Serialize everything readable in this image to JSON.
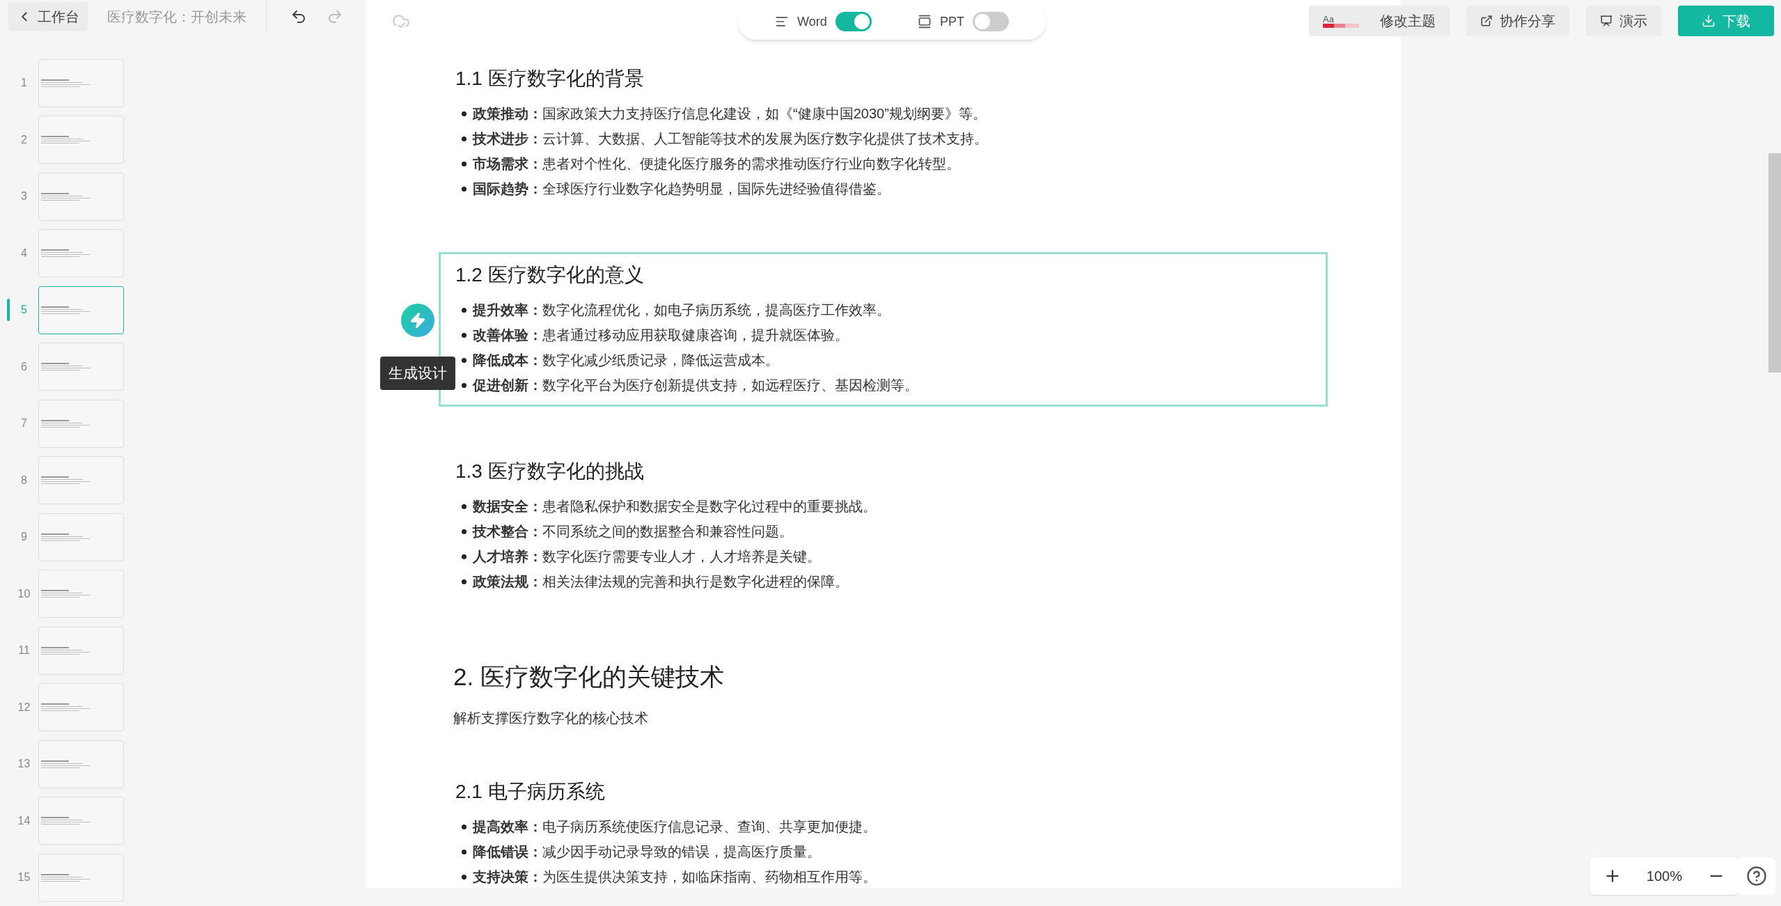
{
  "toolbar": {
    "back_button": "工作台",
    "doc_title": "医疗数字化：开创未来"
  },
  "mode_toggle": [
    {
      "label": "Word",
      "on": true
    },
    {
      "label": "PPT",
      "on": false
    }
  ],
  "actions": [
    {
      "kind": "theme",
      "label": "修改主题",
      "icon_text": "Aa"
    },
    {
      "kind": "share",
      "label": "协作分享"
    },
    {
      "kind": "present",
      "label": "演示"
    },
    {
      "kind": "download",
      "label": "下载"
    }
  ],
  "slides": [
    {
      "number": "1",
      "selected": false
    },
    {
      "number": "2",
      "selected": false
    },
    {
      "number": "3",
      "selected": false
    },
    {
      "number": "4",
      "selected": false
    },
    {
      "number": "5",
      "selected": true
    },
    {
      "number": "6",
      "selected": false
    },
    {
      "number": "7",
      "selected": false
    },
    {
      "number": "8",
      "selected": false
    },
    {
      "number": "9",
      "selected": false
    },
    {
      "number": "10",
      "selected": false
    },
    {
      "number": "11",
      "selected": false
    },
    {
      "number": "12",
      "selected": false
    },
    {
      "number": "13",
      "selected": false
    },
    {
      "number": "14",
      "selected": false
    },
    {
      "number": "15",
      "selected": false
    }
  ],
  "blocks": [
    {
      "kind": "subsection",
      "heading": "1.1 医疗数字化的背景",
      "selected": false,
      "items": [
        "**政策推动：**国家政策大力支持医疗信息化建设，如《“健康中国2030”规划纲要》等。",
        "**技术进步：**云计算、大数据、人工智能等技术的发展为医疗数字化提供了技术支持。",
        "**市场需求：**患者对个性化、便捷化医疗服务的需求推动医疗行业向数字化转型。",
        "**国际趋势：**全球医疗行业数字化趋势明显，国际先进经验值得借鉴。"
      ]
    },
    {
      "kind": "subsection",
      "heading": "1.2 医疗数字化的意义",
      "selected": true,
      "items": [
        "**提升效率：**数字化流程优化，如电子病历系统，提高医疗工作效率。",
        "**改善体验：**患者通过移动应用获取健康咨询，提升就医体验。",
        "**降低成本：**数字化减少纸质记录，降低运营成本。",
        "**促进创新：**数字化平台为医疗创新提供支持，如远程医疗、基因检测等。"
      ]
    },
    {
      "kind": "subsection",
      "heading": "1.3 医疗数字化的挑战",
      "selected": false,
      "items": [
        "**数据安全：**患者隐私保护和数据安全是数字化过程中的重要挑战。",
        "**技术整合：**不同系统之间的数据整合和兼容性问题。",
        "**人才培养：**数字化医疗需要专业人才，人才培养是关键。",
        "**政策法规：**相关法律法规的完善和执行是数字化进程的保障。"
      ]
    },
    {
      "kind": "section",
      "heading": "2. 医疗数字化的关键技术",
      "subtitle": "解析支撑医疗数字化的核心技术"
    },
    {
      "kind": "subsection",
      "heading": "2.1 电子病历系统",
      "selected": false,
      "items": [
        "**提高效率：**电子病历系统使医疗信息记录、查询、共享更加便捷。",
        "**降低错误：**减少因手动记录导致的错误，提高医疗质量。",
        "**支持决策：**为医生提供决策支持，如临床指南、药物相互作用等。"
      ]
    }
  ],
  "tooltip": "生成设计",
  "zoom": {
    "value": "100%"
  }
}
